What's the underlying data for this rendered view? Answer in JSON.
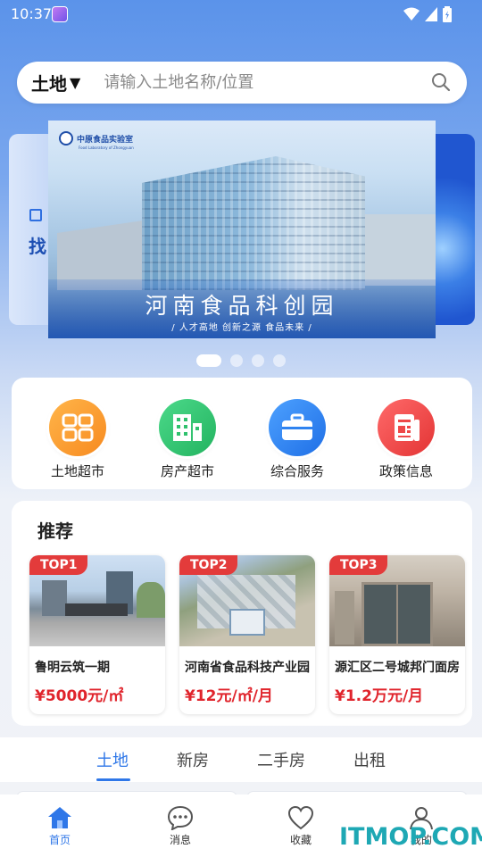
{
  "status_bar": {
    "time": "10:37"
  },
  "search": {
    "city": "土地",
    "arrow": "▼",
    "placeholder": "请输入土地名称/位置"
  },
  "banner": {
    "logo_text": "中原食品实验室",
    "logo_sub": "Food Laboratory of Zhongyuan",
    "title": "河南食品科创园",
    "subtitle": "/ 人才高地  创新之源  食品未来 /",
    "left_peek_text": "找",
    "dots_count": 4,
    "active_dot": 0
  },
  "categories": [
    {
      "label": "土地超市",
      "icon": "grid-icon",
      "color": "#f7922a"
    },
    {
      "label": "房产超市",
      "icon": "building-icon",
      "color": "#2fc16d"
    },
    {
      "label": "综合服务",
      "icon": "briefcase-icon",
      "color": "#2f83f0"
    },
    {
      "label": "政策信息",
      "icon": "document-icon",
      "color": "#ee4848"
    }
  ],
  "recommend": {
    "title": "推荐",
    "items": [
      {
        "badge": "TOP1",
        "name": "鲁明云筑一期",
        "price": "¥5000元/㎡"
      },
      {
        "badge": "TOP2",
        "name": "河南省食品科技产业园",
        "price": "¥12元/㎡/月"
      },
      {
        "badge": "TOP3",
        "name": "源汇区二号城邦门面房",
        "price": "¥1.2万元/月"
      }
    ]
  },
  "tabs": [
    {
      "label": "土地",
      "active": true
    },
    {
      "label": "新房",
      "active": false
    },
    {
      "label": "二手房",
      "active": false
    },
    {
      "label": "出租",
      "active": false
    }
  ],
  "bottom_nav": [
    {
      "label": "首页",
      "icon": "home-icon",
      "active": true
    },
    {
      "label": "消息",
      "icon": "message-icon",
      "active": false
    },
    {
      "label": "收藏",
      "icon": "heart-icon",
      "active": false
    },
    {
      "label": "我的",
      "icon": "user-icon",
      "active": false
    }
  ],
  "watermark": "ITMOP.COM",
  "colors": {
    "accent": "#2f77e8",
    "badge": "#e33b3b",
    "price": "#e0242c"
  }
}
